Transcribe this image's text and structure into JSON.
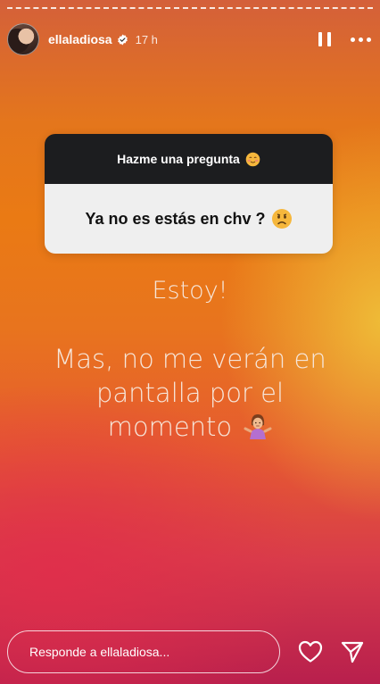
{
  "story": {
    "progress_segments": 7,
    "username": "ellaladiosa",
    "time_ago": "17 h"
  },
  "question_sticker": {
    "prompt": "Hazme una pregunta",
    "question": "Ya no es estás en chv ?"
  },
  "story_text": {
    "line1": "Estoy!",
    "line2a": "Mas, no me verán en",
    "line2b": "pantalla por el",
    "line2c": "momento"
  },
  "reply_bar": {
    "placeholder": "Responde a ellaladiosa..."
  },
  "icons": {
    "verified": "verified-badge-icon",
    "pause": "pause-icon",
    "more": "more-options-icon",
    "heart": "heart-icon",
    "send": "send-icon",
    "emoji_prompt": "smiling-blush-emoji",
    "emoji_question": "frowning-face-emoji",
    "emoji_text": "woman-shrugging-emoji"
  }
}
